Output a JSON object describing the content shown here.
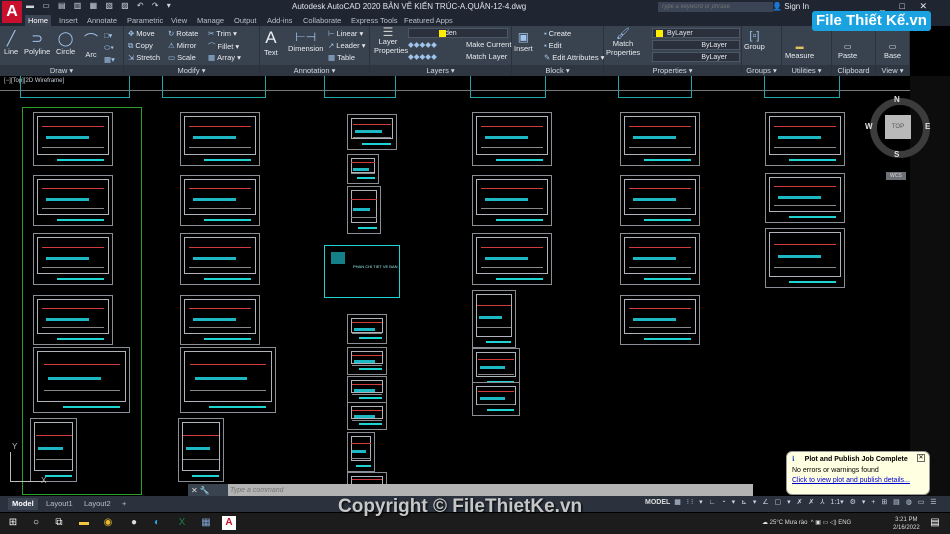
{
  "app": {
    "logo": "A",
    "title": "Autodesk AutoCAD 2020   BẢN VẼ KIẾN TRÚC-A.QUÂN-12-4.dwg",
    "search_placeholder": "Type a keyword or phrase",
    "sign_in": "Sign In",
    "window_controls": "_ □ ✕"
  },
  "tabs": [
    "Home",
    "Insert",
    "Annotate",
    "Parametric",
    "View",
    "Manage",
    "Output",
    "Add-ins",
    "Collaborate",
    "Express Tools",
    "Featured Apps"
  ],
  "ribbon": {
    "draw": {
      "label": "Draw ▾",
      "tools": [
        "Line",
        "Polyline",
        "Circle",
        "Arc"
      ]
    },
    "modify": {
      "label": "Modify ▾",
      "tools": [
        "Move",
        "Rotate",
        "Trim ▾",
        "Copy",
        "Mirror",
        "Fillet ▾",
        "Stretch",
        "Scale",
        "Array ▾"
      ]
    },
    "annotation": {
      "label": "Annotation ▾",
      "tools": [
        "Text",
        "Dimension",
        "Linear ▾",
        "Leader ▾",
        "Table"
      ]
    },
    "layers": {
      "label": "Layers ▾",
      "tools": [
        "Layer Properties",
        "Make Current",
        "Match Layer"
      ],
      "current_layer": "den"
    },
    "block": {
      "label": "Block ▾",
      "tools": [
        "Insert",
        "Create",
        "Edit",
        "Edit Attributes ▾"
      ]
    },
    "properties": {
      "label": "Properties ▾",
      "tools": [
        "Match Properties"
      ],
      "color": "ByLayer",
      "linetype": "ByLayer",
      "lineweight": "ByLayer"
    },
    "groups": {
      "label": "Groups ▾",
      "tools": [
        "Group"
      ]
    },
    "utilities": {
      "label": "Utilities ▾",
      "tools": [
        "Measure"
      ]
    },
    "clipboard": {
      "label": "Clipboard",
      "tools": [
        "Paste"
      ]
    },
    "view": {
      "label": "View ▾",
      "tools": [
        "Base"
      ]
    }
  },
  "viewport": {
    "label": "[−][Top][2D Wireframe]",
    "center_sheet_title": "PHAN CHI TIET VE BAN",
    "viewcube": {
      "top": "TOP",
      "n": "N",
      "s": "S",
      "w": "W",
      "e": "E",
      "wcs": "WCS"
    },
    "ucs_x": "X",
    "ucs_y": "Y"
  },
  "command": {
    "placeholder": "Type a command",
    "buttons": "✕ 🔧"
  },
  "layout_tabs": [
    "Model",
    "Layout1",
    "Layout2",
    "+"
  ],
  "status": {
    "mode": "MODEL",
    "scale": "1:1"
  },
  "notification": {
    "title": "Plot and Publish Job Complete",
    "message": "No errors or warnings found",
    "link": "Click to view plot and publish details..."
  },
  "taskbar": {
    "weather": "25°C  Mưa rào",
    "lang": "ENG",
    "time": "3:21 PM",
    "date": "2/16/2022"
  },
  "watermark": "Copyright © FileThietKe.vn",
  "brand": "File Thiết Kế.vn",
  "colors": {
    "accent_cyan": "#1fd3d3",
    "ribbon_bg": "#39424f",
    "autocad_red": "#c8102e",
    "layer_color": "#ffee00"
  }
}
